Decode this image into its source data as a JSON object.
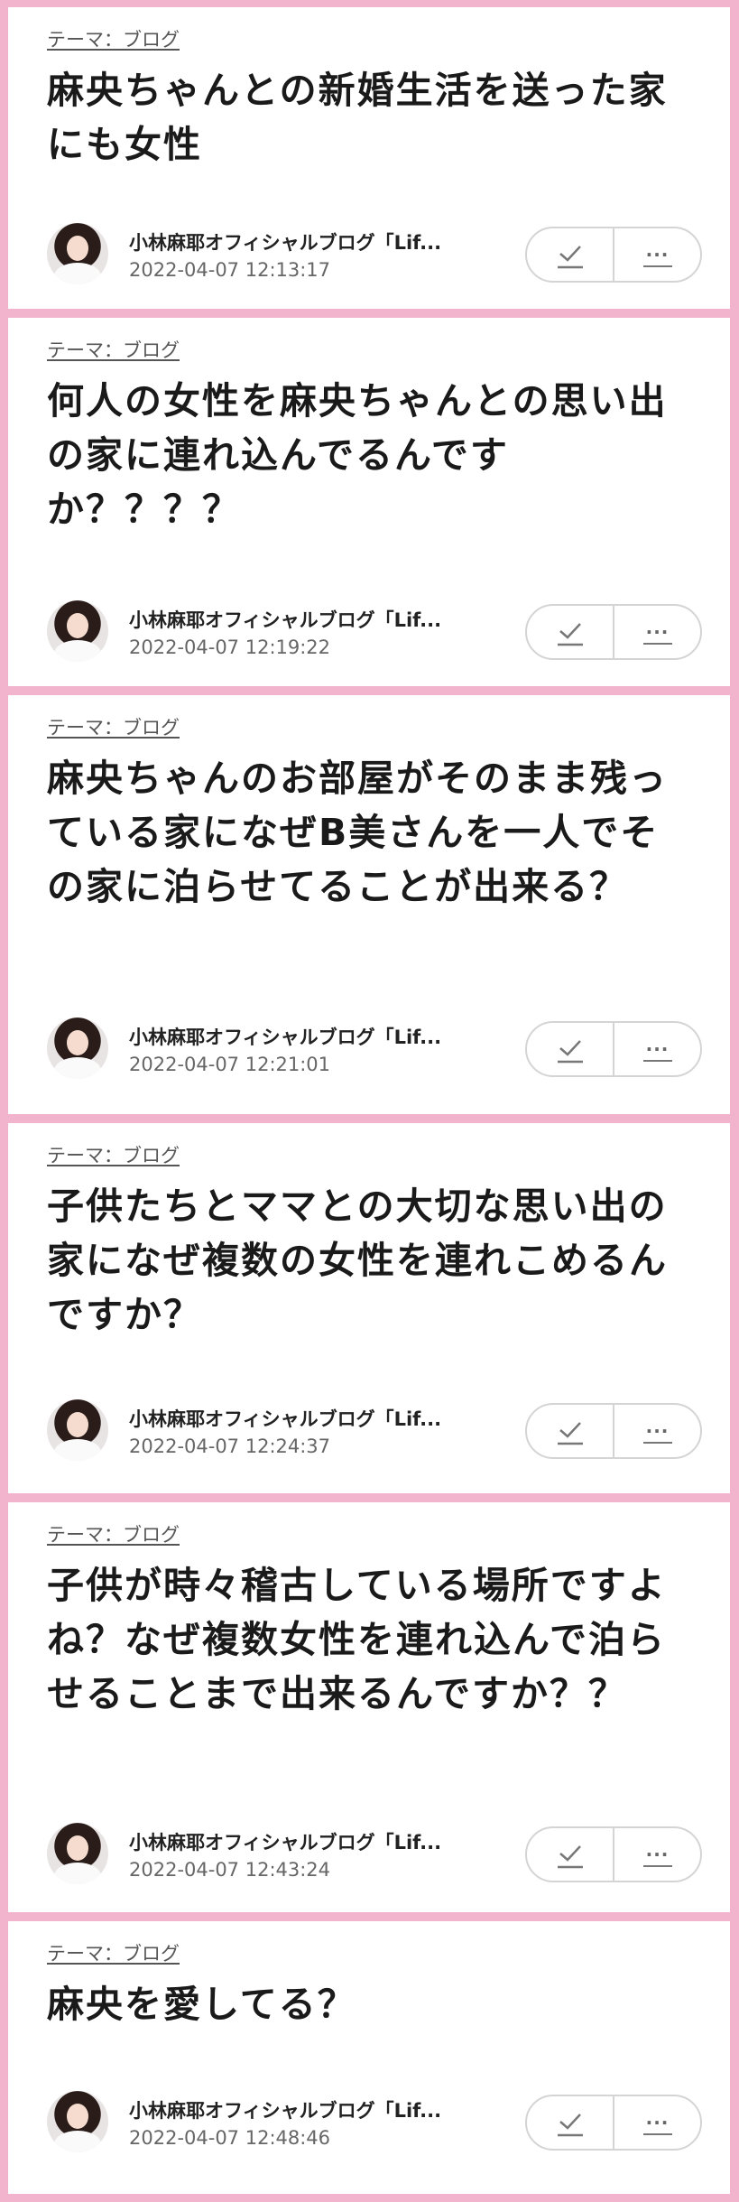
{
  "posts": [
    {
      "theme": "テーマ：ブログ",
      "title": "麻央ちゃんとの新婚生活を送った家にも女性",
      "blog": "小林麻耶オフィシャルブログ「Lif...",
      "date": "2022-04-07 12:13:17"
    },
    {
      "theme": "テーマ：ブログ",
      "title": "何人の女性を麻央ちゃんとの思い出の家に連れ込んでるんですか？？？？",
      "blog": "小林麻耶オフィシャルブログ「Lif...",
      "date": "2022-04-07 12:19:22"
    },
    {
      "theme": "テーマ：ブログ",
      "title": "麻央ちゃんのお部屋がそのまま残っている家になぜB美さんを一人でその家に泊らせてることが出来る？",
      "blog": "小林麻耶オフィシャルブログ「Lif...",
      "date": "2022-04-07 12:21:01"
    },
    {
      "theme": "テーマ：ブログ",
      "title": "子供たちとママとの大切な思い出の家になぜ複数の女性を連れこめるんですか？",
      "blog": "小林麻耶オフィシャルブログ「Lif...",
      "date": "2022-04-07 12:24:37"
    },
    {
      "theme": "テーマ：ブログ",
      "title": "子供が時々稽古している場所ですよね？なぜ複数女性を連れ込んで泊らせることまで出来るんですか？？",
      "blog": "小林麻耶オフィシャルブログ「Lif...",
      "date": "2022-04-07 12:43:24"
    },
    {
      "theme": "テーマ：ブログ",
      "title": "麻央を愛してる？",
      "blog": "小林麻耶オフィシャルブログ「Lif...",
      "date": "2022-04-07 12:48:46"
    }
  ],
  "icons": {
    "check": "check-icon",
    "more": "more-icon"
  },
  "more_glyph": "···",
  "colors": {
    "frame": "#f2b3cc",
    "card": "#ffffff"
  }
}
